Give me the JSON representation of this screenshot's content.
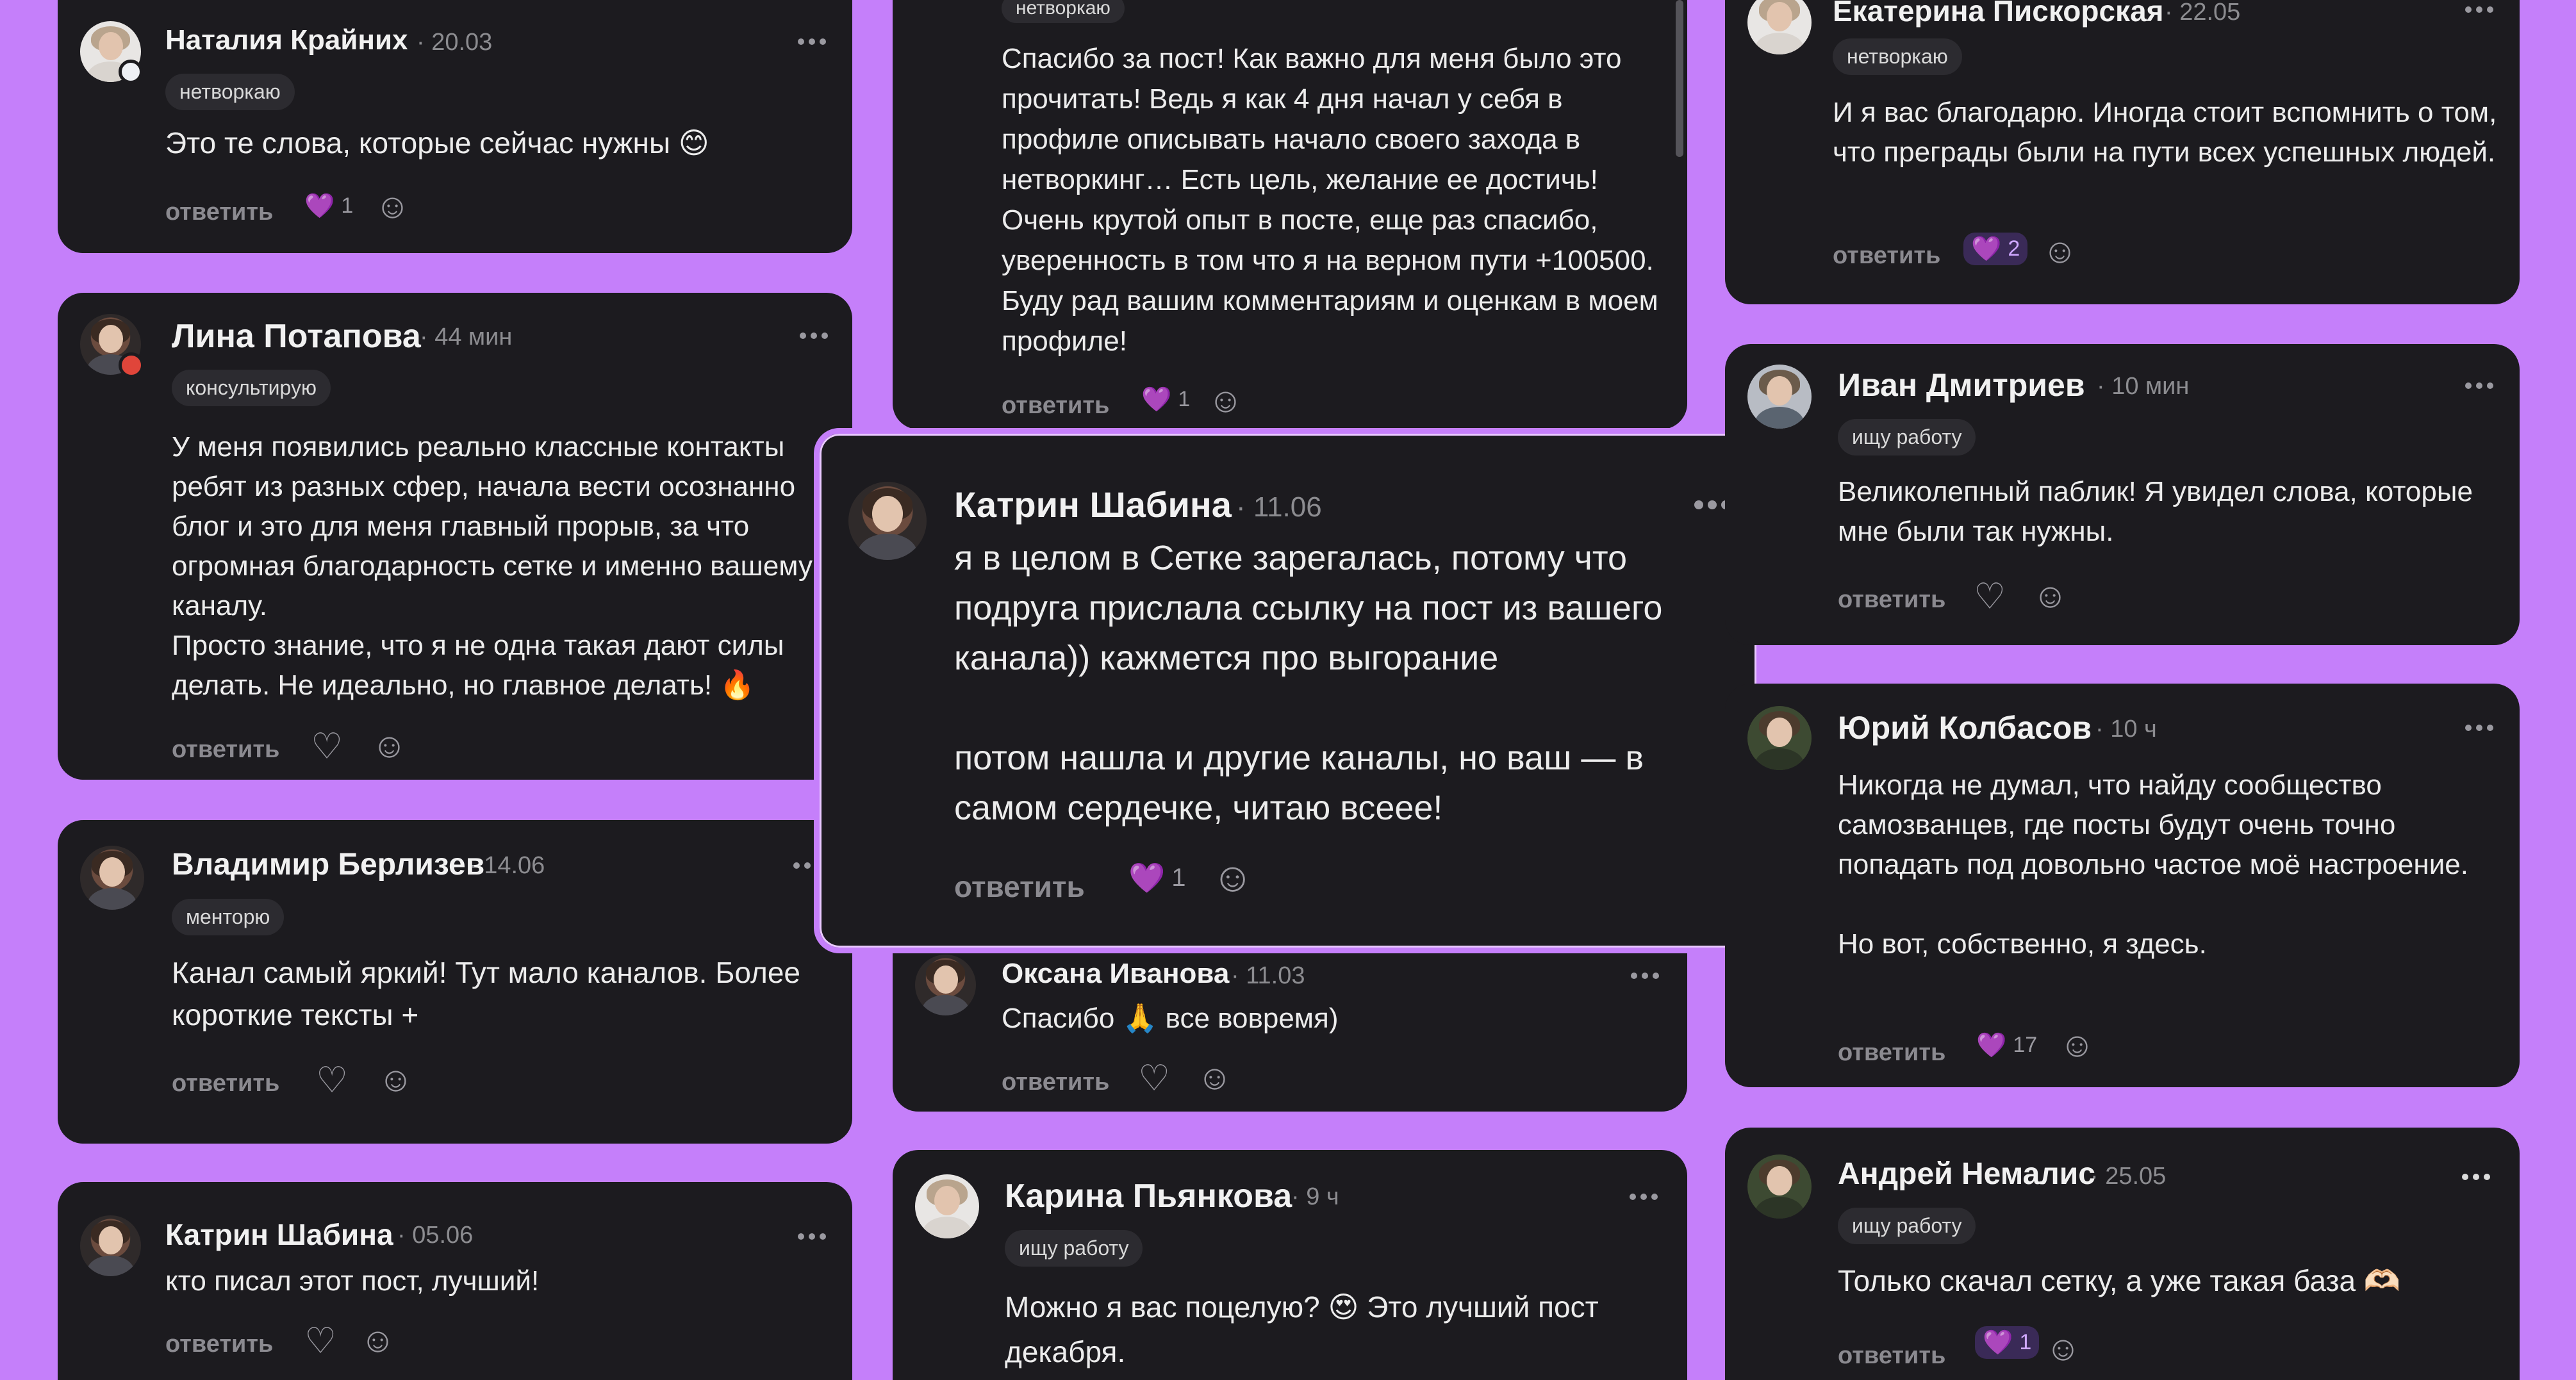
{
  "ui": {
    "reply_label": "ответить",
    "heart_glyph": "💜",
    "heart_outline_glyph": "♡",
    "react_glyph": "☺"
  },
  "comments": [
    {
      "id": "c1",
      "author": "Наталия Крайних",
      "time": "· 20.03",
      "tag": "нетворкаю",
      "text": "Это те слова, которые сейчас нужны 😊",
      "likes": "1"
    },
    {
      "id": "c2",
      "author": "Лина Потапова",
      "time": "· 44 мин",
      "tag": "консультирую",
      "text": "У меня появились реально классные контакты ребят из разных сфер, начала вести осознанно блог и это для меня главный прорыв, за что огромная благодарность сетке и именно вашему каналу.\nПросто знание, что я не одна такая дают силы делать. Не идеально, но главное делать! 🔥"
    },
    {
      "id": "c3",
      "author": "Владимир Берлизев",
      "time": "· 14.06",
      "tag": "менторю",
      "text": "Канал самый яркий! Тут мало каналов. Более короткие тексты +"
    },
    {
      "id": "c4",
      "author": "Катрин Шабина",
      "time": "· 05.06",
      "text": "кто писал этот пост, лучший!"
    },
    {
      "id": "c5",
      "tag": "нетворкаю",
      "text": "Спасибо за пост! Как важно для меня было это прочитать! Ведь я как 4 дня начал у себя в профиле описывать начало своего захода в нетворкинг… Есть цель, желание ее достичь! Очень крутой опыт в посте, еще раз спасибо, уверенность в том что я на верном пути +100500. Буду рад вашим комментариям и оценкам в моем профиле!",
      "likes": "1"
    },
    {
      "id": "c6",
      "author": "Катрин Шабина",
      "time": "· 11.06",
      "text": "я в целом в Сетке зарегалась, потому что подруга прислала ссылку на пост из вашего канала)) кажмется про выгорание\n\nпотом нашла и другие каналы, но ваш — в самом сердечке, читаю всеее!",
      "likes": "1"
    },
    {
      "id": "c7",
      "author": "Оксана Иванова",
      "time": "· 11.03",
      "text": "Спасибо 🙏 все вовремя)"
    },
    {
      "id": "c8",
      "author": "Карина Пьянкова",
      "time": "· 9 ч",
      "tag": "ищу работу",
      "text": "Можно я вас поцелую? 😍 Это лучший пост декабря."
    },
    {
      "id": "c9",
      "author": "Екатерина Пискорская",
      "time": "· 22.05",
      "tag": "нетворкаю",
      "text": "И я вас благодарю. Иногда стоит вспомнить о том, что преграды были на пути всех успешных людей.",
      "likes": "2"
    },
    {
      "id": "c10",
      "author": "Иван Дмитриев",
      "time": "· 10 мин",
      "tag": "ищу работу",
      "text": "Великолепный паблик! Я увидел слова, которые мне были так нужны."
    },
    {
      "id": "c11",
      "author": "Юрий Колбасов",
      "time": "· 10 ч",
      "text": "Никогда не думал, что найду сообщество самозванцев, где посты будут очень точно попадать под довольно частое моё настроение.\n\nНо вот, собственно, я здесь.",
      "likes": "17"
    },
    {
      "id": "c12",
      "author": "Андрей Немалис",
      "time": "· 25.05",
      "tag": "ищу работу",
      "text": "Только скачал сетку, а уже такая база 🫶🏻",
      "likes": "1"
    }
  ]
}
